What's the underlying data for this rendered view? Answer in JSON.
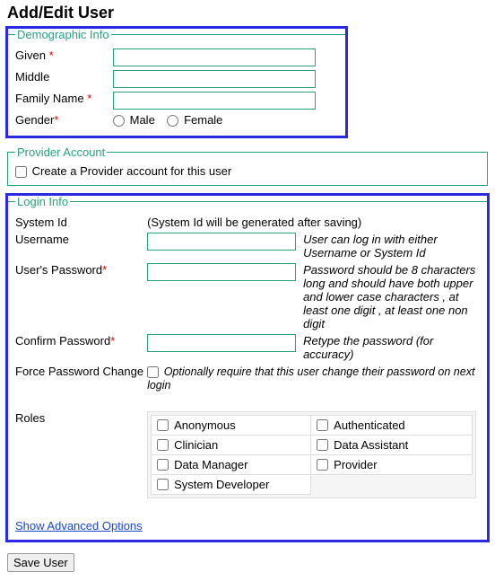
{
  "title": "Add/Edit User",
  "demographic": {
    "legend": "Demographic Info",
    "given_label": "Given",
    "middle_label": "Middle",
    "family_label": "Family Name",
    "gender_label": "Gender",
    "male_label": "Male",
    "female_label": "Female",
    "given_value": "",
    "middle_value": "",
    "family_value": "",
    "required_marker": "*"
  },
  "provider": {
    "legend": "Provider Account",
    "create_label": "Create a Provider account for this user"
  },
  "login": {
    "legend": "Login Info",
    "system_id_label": "System Id",
    "system_id_hint": "(System Id will be generated after saving)",
    "username_label": "Username",
    "username_hint": "User can log in with either Username or System Id",
    "username_value": "",
    "password_label": "User's Password",
    "password_hint": "Password should be 8 characters long and should have both upper and lower case characters , at least one digit , at least one non digit",
    "password_value": "",
    "confirm_label": "Confirm Password",
    "confirm_hint": "Retype the password (for accuracy)",
    "confirm_value": "",
    "force_label": "Force Password Change",
    "force_hint": "Optionally require that this user change their password on next login",
    "roles_label": "Roles",
    "roles": [
      [
        "Anonymous",
        "Authenticated"
      ],
      [
        "Clinician",
        "Data Assistant"
      ],
      [
        "Data Manager",
        "Provider"
      ],
      [
        "System Developer",
        ""
      ]
    ],
    "advanced_link": "Show Advanced Options",
    "required_marker": "*"
  },
  "save_label": "Save User"
}
